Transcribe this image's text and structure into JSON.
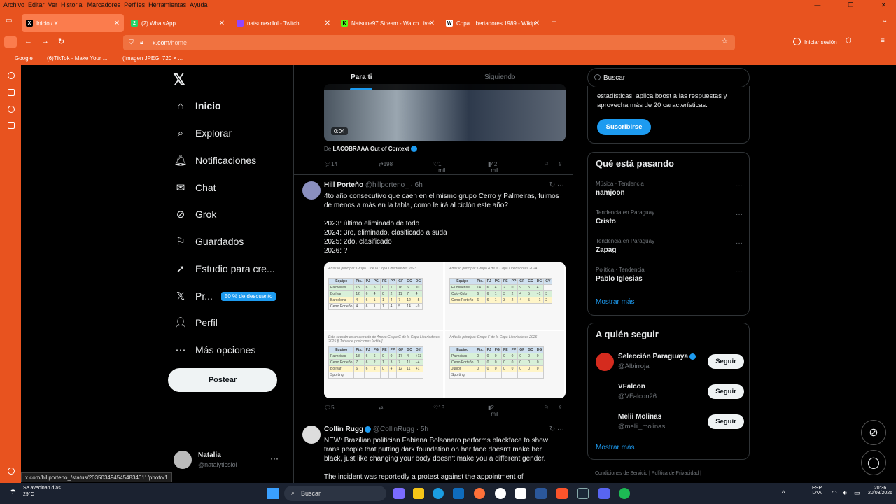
{
  "browser": {
    "menu": [
      "Archivo",
      "Editar",
      "Ver",
      "Historial",
      "Marcadores",
      "Perfiles",
      "Herramientas",
      "Ayuda"
    ],
    "tabs": [
      {
        "label": "Inicio / X",
        "icon": "x-logo-icon",
        "active": true
      },
      {
        "label": "(2) WhatsApp",
        "icon": "whatsapp-icon"
      },
      {
        "label": "natsunexdlol - Twitch",
        "icon": "twitch-icon"
      },
      {
        "label": "Natsune97 Stream - Watch Live",
        "icon": "kick-icon"
      },
      {
        "label": "Copa Libertadores 1989 - Wikip",
        "icon": "wikipedia-icon"
      }
    ],
    "url_domain": "x.com",
    "url_path": "/home",
    "signin_label": "Iniciar sesión",
    "bookmarks": [
      "Google",
      "(6)TikTok - Make Your ...",
      "(Imagen JPEG, 720 × ..."
    ],
    "status_url": "x.com/hillporteno_/status/2035034945454834011/photo/1"
  },
  "nav": {
    "items": [
      "Inicio",
      "Explorar",
      "Notificaciones",
      "Chat",
      "Grok",
      "Guardados",
      "Estudio para cre...",
      "Pr...",
      "Perfil",
      "Más opciones"
    ],
    "premium_badge": "50 % de descuento",
    "post_label": "Postear",
    "profile_name": "Natalia",
    "profile_handle": "@natalyticslol",
    "more_glyph": "···"
  },
  "timeline": {
    "tab_for_you": "Para ti",
    "tab_following": "Siguiendo",
    "video_duration": "0:04",
    "source_prefix": "De",
    "source_name": "LACOBRAAA Out of Context",
    "tweet1_stats": {
      "replies": "14",
      "retweets": "198",
      "likes": "1 mil",
      "views": "42 mil"
    },
    "tweet2": {
      "name": "Hill Porteño",
      "handle": "@hillporteno_ · 6h",
      "text1": "4to año consecutivo que caen en el mismo grupo Cerro y Palmeiras, fuimos",
      "text2": "de menos a más en la tabla, como le irá al ciclón este año?",
      "lines": [
        "2023: último eliminado de todo",
        "2024: 3ro, eliminado, clasificado a suda",
        "2025: 2do, clasificado",
        "2026: ?"
      ],
      "stats": {
        "replies": "5",
        "likes": "18",
        "views": "2 mil"
      }
    },
    "tables": [
      {
        "caption": "Grupo C",
        "sub": "Artículo principal: Grupo C de la Copa Libertadores 2023",
        "head": [
          "Equipo",
          "Pts.",
          "PJ",
          "PG",
          "PE",
          "PP",
          "GF",
          "GC",
          "DG"
        ],
        "rows": [
          [
            "Palmeiras",
            "15",
            "6",
            "5",
            "0",
            "1",
            "16",
            "6",
            "10"
          ],
          [
            "Bolívar",
            "12",
            "6",
            "4",
            "0",
            "2",
            "11",
            "7",
            "4"
          ],
          [
            "Barcelona",
            "4",
            "6",
            "1",
            "1",
            "4",
            "7",
            "12",
            "−5"
          ],
          [
            "Cerro Porteño",
            "4",
            "6",
            "1",
            "1",
            "4",
            "5",
            "14",
            "−9"
          ]
        ]
      },
      {
        "caption": "",
        "sub": "Artículo principal: Grupo A de la Copa Libertadores 2024",
        "head": [
          "Equipo",
          "Pts.",
          "PJ",
          "PG",
          "PE",
          "PP",
          "GF",
          "GC",
          "DG",
          "GV"
        ],
        "rows": [
          [
            "Fluminense",
            "14",
            "6",
            "4",
            "2",
            "0",
            "9",
            "5",
            "4"
          ],
          [
            "Colo-Colo",
            "6",
            "6",
            "1",
            "3",
            "2",
            "4",
            "5",
            "−1",
            "3"
          ],
          [
            "Cerro Porteño",
            "6",
            "6",
            "1",
            "3",
            "2",
            "4",
            "5",
            "−1",
            "2"
          ]
        ]
      },
      {
        "caption": "",
        "sub": "Esta sección es un extracto de Anexo:Grupo G de la Copa Libertadores 2025 § Tabla de posiciones.[editar]",
        "head": [
          "Equipo",
          "Pts.",
          "PJ",
          "PG",
          "PE",
          "PP",
          "GF",
          "GC",
          "Dif."
        ],
        "rows": [
          [
            "Palmeiras",
            "18",
            "6",
            "6",
            "0",
            "0",
            "17",
            "4",
            "+13"
          ],
          [
            "Cerro Porteño",
            "7",
            "6",
            "2",
            "1",
            "3",
            "7",
            "11",
            "−4"
          ],
          [
            "Bolívar",
            "6",
            "6",
            "2",
            "0",
            "4",
            "12",
            "11",
            "+1"
          ],
          [
            "Sporting",
            "",
            "",
            "",
            "",
            "",
            "",
            "",
            ""
          ]
        ]
      },
      {
        "caption": "",
        "sub": "Artículo principal: Grupo F de la Copa Libertadores 2026",
        "head": [
          "Equipo",
          "Pts.",
          "PJ",
          "PG",
          "PE",
          "PP",
          "GF",
          "GC",
          "DG"
        ],
        "rows": [
          [
            "Palmeiras",
            "0",
            "0",
            "0",
            "0",
            "0",
            "0",
            "0",
            "0"
          ],
          [
            "Cerro Porteño",
            "0",
            "0",
            "0",
            "0",
            "0",
            "0",
            "0",
            "0"
          ],
          [
            "Junior",
            "0",
            "0",
            "0",
            "0",
            "0",
            "0",
            "0",
            "0"
          ],
          [
            "Sporting",
            "",
            "",
            "",
            "",
            "",
            "",
            "",
            ""
          ]
        ]
      }
    ],
    "tweet3": {
      "name": "Collin Rugg",
      "handle": "@CollinRugg · 5h",
      "l1": "NEW: Brazilian politician Fabiana Bolsonaro performs blackface to show",
      "l2": "trans people that putting dark foundation on her face doesn't make her",
      "l3": "black, just like changing your body doesn't make you a different gender.",
      "l4": "The incident was reportedly a protest against the appointment of"
    }
  },
  "right": {
    "search_placeholder": "Buscar",
    "premium_text1": "estadísticas, aplica boost a las respuestas y",
    "premium_text2": "aprovecha más de 20 características.",
    "subscribe_label": "Suscribirse",
    "trends_title": "Qué está pasando",
    "trends": [
      {
        "meta": "Música · Tendencia",
        "name": "namjoon"
      },
      {
        "meta": "Tendencia en Paraguay",
        "name": "Cristo"
      },
      {
        "meta": "Tendencia en Paraguay",
        "name": "Zapag"
      },
      {
        "meta": "Política · Tendencia",
        "name": "Pablo Iglesias"
      }
    ],
    "show_more": "Mostrar más",
    "follow_title": "A quién seguir",
    "follow": [
      {
        "name": "Selección Paraguaya",
        "handle": "@Albirroja",
        "button": "Seguir"
      },
      {
        "name": "VFalcon",
        "handle": "@VFalcon26",
        "button": "Seguir"
      },
      {
        "name": "Melii Molinas",
        "handle": "@melii_molinas",
        "button": "Seguir"
      }
    ],
    "footer": "Condiciones de Servicio  |  Política de Privacidad  |"
  },
  "taskbar": {
    "weather_text": "Se avecinan días...",
    "weather_temp": "29°C",
    "search": "Buscar",
    "lang": "ESP",
    "lang2": "LAA",
    "time": "20:36",
    "date": "20/03/2026"
  },
  "colors": {
    "firefox_orange": "#e8531f",
    "x_blue": "#1d9bf0",
    "bg": "#000000"
  }
}
